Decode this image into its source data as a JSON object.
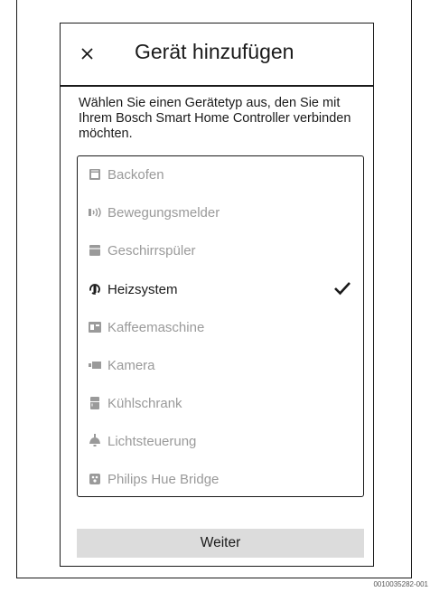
{
  "header": {
    "title": "Gerät hinzufügen"
  },
  "intro": "Wählen Sie einen Gerätetyp aus, den Sie mit Ihrem Bosch Smart Home Controller verbinden möchten.",
  "device_list": {
    "items": [
      {
        "label": "Backofen",
        "icon": "oven-icon",
        "selected": false
      },
      {
        "label": "Bewegungsmelder",
        "icon": "motion-sensor-icon",
        "selected": false
      },
      {
        "label": "Geschirrspüler",
        "icon": "dishwasher-icon",
        "selected": false
      },
      {
        "label": "Heizsystem",
        "icon": "heating-system-icon",
        "selected": true
      },
      {
        "label": "Kaffeemaschine",
        "icon": "coffee-machine-icon",
        "selected": false
      },
      {
        "label": "Kamera",
        "icon": "camera-icon",
        "selected": false
      },
      {
        "label": "Kühlschrank",
        "icon": "fridge-icon",
        "selected": false
      },
      {
        "label": "Lichtsteuerung",
        "icon": "light-control-icon",
        "selected": false
      },
      {
        "label": "Philips Hue Bridge",
        "icon": "hue-bridge-icon",
        "selected": false
      }
    ]
  },
  "footer": {
    "next_label": "Weiter"
  },
  "figure_id": "0010035282-001",
  "colors": {
    "text": "#1a1a1a",
    "disabled": "#9a9a9a",
    "button_bg": "#dcdcdc"
  }
}
